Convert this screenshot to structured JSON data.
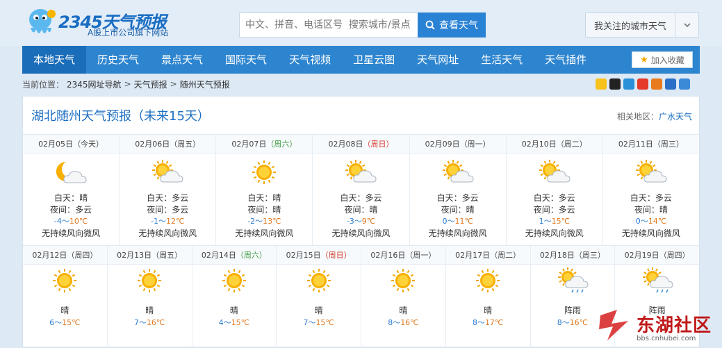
{
  "header": {
    "logo_brand": "2345天气预报",
    "logo_sub": "A股上市公司旗下网站",
    "search_placeholder": "中文、拼音、电话区号  搜索城市/景点",
    "search_button": "查看天气",
    "follow_label": "我关注的城市天气"
  },
  "nav": {
    "items": [
      "本地天气",
      "历史天气",
      "景点天气",
      "国际天气",
      "天气视频",
      "卫星云图",
      "天气网址",
      "生活天气",
      "天气插件"
    ],
    "fav_label": "加入收藏"
  },
  "breadcrumb": {
    "prefix": "当前位置：",
    "links": [
      "2345网址导航",
      "天气预报",
      "随州天气预报"
    ],
    "sep": ">"
  },
  "panel": {
    "title": "湖北随州天气预报（未来15天）",
    "related_label": "相关地区：",
    "related_link": "广水天气"
  },
  "labels": {
    "day": "白天：",
    "night": "夜间："
  },
  "forecast_row1": [
    {
      "date": "02月05日",
      "weekday": "（今天）",
      "icon": "moon-cloud-icon",
      "day": "晴",
      "night": "多云",
      "lo": "-4",
      "hi": "10℃",
      "wind": "无持续风向微风",
      "wk": ""
    },
    {
      "date": "02月06日",
      "weekday": "（周五）",
      "icon": "sun-cloud-icon",
      "day": "多云",
      "night": "多云",
      "lo": "-1",
      "hi": "12℃",
      "wind": "无持续风向微风",
      "wk": ""
    },
    {
      "date": "02月07日",
      "weekday": "（周六）",
      "icon": "sun-icon",
      "day": "晴",
      "night": "晴",
      "lo": "-2",
      "hi": "13℃",
      "wind": "无持续风向微风",
      "wk": "sat"
    },
    {
      "date": "02月08日",
      "weekday": "（周日）",
      "icon": "sun-cloud-icon",
      "day": "多云",
      "night": "晴",
      "lo": "-3",
      "hi": "9℃",
      "wind": "无持续风向微风",
      "wk": "sun"
    },
    {
      "date": "02月09日",
      "weekday": "（周一）",
      "icon": "sun-cloud-icon",
      "day": "多云",
      "night": "晴",
      "lo": "0",
      "hi": "11℃",
      "wind": "无持续风向微风",
      "wk": ""
    },
    {
      "date": "02月10日",
      "weekday": "（周二）",
      "icon": "sun-cloud-icon",
      "day": "多云",
      "night": "多云",
      "lo": "1",
      "hi": "15℃",
      "wind": "无持续风向微风",
      "wk": ""
    },
    {
      "date": "02月11日",
      "weekday": "（周三）",
      "icon": "sun-cloud-icon",
      "day": "多云",
      "night": "晴",
      "lo": "0",
      "hi": "14℃",
      "wind": "无持续风向微风",
      "wk": ""
    }
  ],
  "forecast_row2": [
    {
      "date": "02月12日",
      "weekday": "（周四）",
      "icon": "sun-icon",
      "weather": "晴",
      "lo": "6",
      "hi": "15℃",
      "wk": ""
    },
    {
      "date": "02月13日",
      "weekday": "（周五）",
      "icon": "sun-icon",
      "weather": "晴",
      "lo": "7",
      "hi": "16℃",
      "wk": ""
    },
    {
      "date": "02月14日",
      "weekday": "（周六）",
      "icon": "sun-icon",
      "weather": "晴",
      "lo": "4",
      "hi": "15℃",
      "wk": "sat"
    },
    {
      "date": "02月15日",
      "weekday": "（周日）",
      "icon": "sun-icon",
      "weather": "晴",
      "lo": "7",
      "hi": "15℃",
      "wk": "sun"
    },
    {
      "date": "02月16日",
      "weekday": "（周一）",
      "icon": "sun-icon",
      "weather": "晴",
      "lo": "8",
      "hi": "16℃",
      "wk": ""
    },
    {
      "date": "02月17日",
      "weekday": "（周二）",
      "icon": "sun-icon",
      "weather": "晴",
      "lo": "8",
      "hi": "17℃",
      "wk": ""
    },
    {
      "date": "02月18日",
      "weekday": "（周三）",
      "icon": "sun-rain-icon",
      "weather": "阵雨",
      "lo": "8",
      "hi": "16℃",
      "wk": ""
    },
    {
      "date": "02月19日",
      "weekday": "（周四）",
      "icon": "sun-rain-icon",
      "weather": "阵雨",
      "lo": "",
      "hi": "",
      "wk": ""
    }
  ],
  "watermark": {
    "text": "东湖社区",
    "url": "bbs.cnhubei.com"
  },
  "colors": {
    "nav_bg": "#2e85cf",
    "nav_active": "#1a6db8",
    "accent": "#1a6dc2",
    "low_temp": "#2a7bd0",
    "high_temp": "#e07820",
    "saturday": "#3a9a3a",
    "sunday": "#d43a2a"
  }
}
